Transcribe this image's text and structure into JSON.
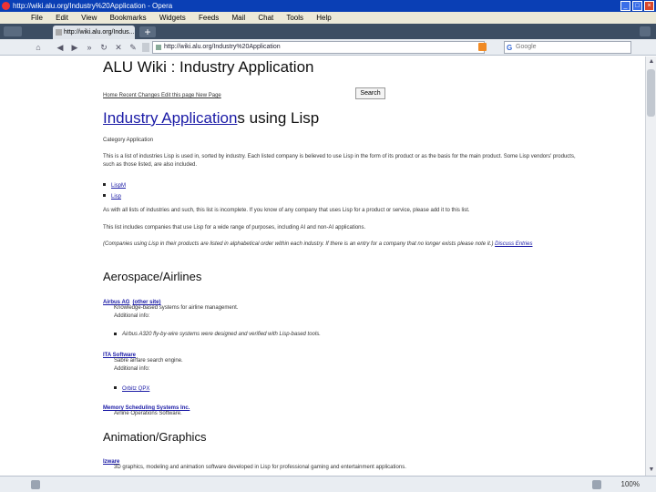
{
  "window": {
    "title": "http://wiki.alu.org/Industry%20Application - Opera"
  },
  "menu": [
    "File",
    "Edit",
    "View",
    "Bookmarks",
    "Widgets",
    "Feeds",
    "Mail",
    "Chat",
    "Tools",
    "Help"
  ],
  "tab": {
    "label": "http://wiki.alu.org/Indus..."
  },
  "address": {
    "value": "http://wiki.alu.org/Industry%20Application"
  },
  "search": {
    "placeholder": "Google"
  },
  "page": {
    "title": "ALU Wiki : Industry Application",
    "nav": "Home  Recent Changes  Edit this page  New Page",
    "search_button": "Search",
    "heading_link": "Industry Application",
    "heading_rest": "s using Lisp",
    "subtitle": "Category Application",
    "intro": "This is a list of industries Lisp is used in, sorted by industry. Each listed company is believed to use Lisp in the form of its product or as the basis for the main product. Some Lisp vendors' products, such as those listed, are also included.",
    "bullets": [
      "LispM",
      "Lisp"
    ],
    "para2": "As with all lists of industries and such, this list is incomplete. If you know of any company that uses Lisp for a product or service, please add it to this list.",
    "para3": "This list includes companies that use Lisp for a wide range of purposes, including AI and non-AI applications.",
    "para4_italic": "(Companies using Lisp in their products are listed in alphabetical order within each industry. If there is an entry for a company that no longer exists please note it.)",
    "para4_link": "Discuss Entries",
    "sections": [
      {
        "heading": "Aerospace/Airlines",
        "companies": [
          {
            "name": "Airbus AG",
            "extra": "(other site)",
            "lines": [
              "Knowledge-based systems for airline management.",
              "Additional info:"
            ],
            "note": "Airbus A320 fly-by-wire systems were designed and verified with Lisp-based tools."
          },
          {
            "name": "ITA Software",
            "lines": [
              "Sabre airfare search engine.",
              "Additional info:"
            ],
            "links": [
              "Orbitz QPX"
            ]
          },
          {
            "name": "Memory Scheduling Systems Inc.",
            "lines": [
              "Airline Operations Software."
            ]
          }
        ]
      },
      {
        "heading": "Animation/Graphics",
        "companies": [
          {
            "name": "Izware",
            "lines": [
              "3D graphics, modeling and animation software developed in Lisp for professional gaming and entertainment applications."
            ]
          }
        ]
      }
    ]
  },
  "status": {
    "zoom": "100%"
  }
}
